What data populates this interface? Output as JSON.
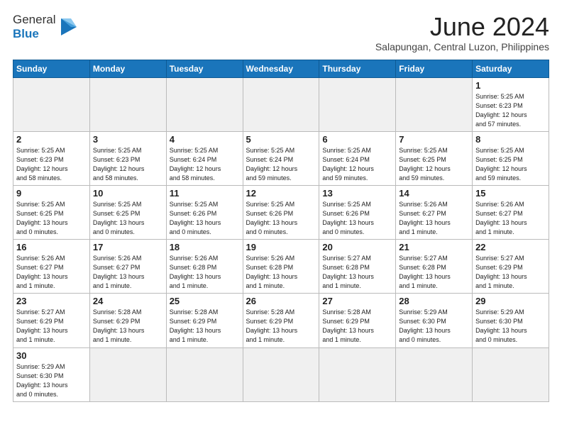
{
  "header": {
    "logo_general": "General",
    "logo_blue": "Blue",
    "month_title": "June 2024",
    "location": "Salapungan, Central Luzon, Philippines"
  },
  "weekdays": [
    "Sunday",
    "Monday",
    "Tuesday",
    "Wednesday",
    "Thursday",
    "Friday",
    "Saturday"
  ],
  "weeks": [
    [
      {
        "day": "",
        "info": "",
        "empty": true
      },
      {
        "day": "",
        "info": "",
        "empty": true
      },
      {
        "day": "",
        "info": "",
        "empty": true
      },
      {
        "day": "",
        "info": "",
        "empty": true
      },
      {
        "day": "",
        "info": "",
        "empty": true
      },
      {
        "day": "",
        "info": "",
        "empty": true
      },
      {
        "day": "1",
        "info": "Sunrise: 5:25 AM\nSunset: 6:23 PM\nDaylight: 12 hours\nand 57 minutes."
      }
    ],
    [
      {
        "day": "2",
        "info": "Sunrise: 5:25 AM\nSunset: 6:23 PM\nDaylight: 12 hours\nand 58 minutes."
      },
      {
        "day": "3",
        "info": "Sunrise: 5:25 AM\nSunset: 6:23 PM\nDaylight: 12 hours\nand 58 minutes."
      },
      {
        "day": "4",
        "info": "Sunrise: 5:25 AM\nSunset: 6:24 PM\nDaylight: 12 hours\nand 58 minutes."
      },
      {
        "day": "5",
        "info": "Sunrise: 5:25 AM\nSunset: 6:24 PM\nDaylight: 12 hours\nand 59 minutes."
      },
      {
        "day": "6",
        "info": "Sunrise: 5:25 AM\nSunset: 6:24 PM\nDaylight: 12 hours\nand 59 minutes."
      },
      {
        "day": "7",
        "info": "Sunrise: 5:25 AM\nSunset: 6:25 PM\nDaylight: 12 hours\nand 59 minutes."
      },
      {
        "day": "8",
        "info": "Sunrise: 5:25 AM\nSunset: 6:25 PM\nDaylight: 12 hours\nand 59 minutes."
      }
    ],
    [
      {
        "day": "9",
        "info": "Sunrise: 5:25 AM\nSunset: 6:25 PM\nDaylight: 13 hours\nand 0 minutes."
      },
      {
        "day": "10",
        "info": "Sunrise: 5:25 AM\nSunset: 6:25 PM\nDaylight: 13 hours\nand 0 minutes."
      },
      {
        "day": "11",
        "info": "Sunrise: 5:25 AM\nSunset: 6:26 PM\nDaylight: 13 hours\nand 0 minutes."
      },
      {
        "day": "12",
        "info": "Sunrise: 5:25 AM\nSunset: 6:26 PM\nDaylight: 13 hours\nand 0 minutes."
      },
      {
        "day": "13",
        "info": "Sunrise: 5:25 AM\nSunset: 6:26 PM\nDaylight: 13 hours\nand 0 minutes."
      },
      {
        "day": "14",
        "info": "Sunrise: 5:26 AM\nSunset: 6:27 PM\nDaylight: 13 hours\nand 1 minute."
      },
      {
        "day": "15",
        "info": "Sunrise: 5:26 AM\nSunset: 6:27 PM\nDaylight: 13 hours\nand 1 minute."
      }
    ],
    [
      {
        "day": "16",
        "info": "Sunrise: 5:26 AM\nSunset: 6:27 PM\nDaylight: 13 hours\nand 1 minute."
      },
      {
        "day": "17",
        "info": "Sunrise: 5:26 AM\nSunset: 6:27 PM\nDaylight: 13 hours\nand 1 minute."
      },
      {
        "day": "18",
        "info": "Sunrise: 5:26 AM\nSunset: 6:28 PM\nDaylight: 13 hours\nand 1 minute."
      },
      {
        "day": "19",
        "info": "Sunrise: 5:26 AM\nSunset: 6:28 PM\nDaylight: 13 hours\nand 1 minute."
      },
      {
        "day": "20",
        "info": "Sunrise: 5:27 AM\nSunset: 6:28 PM\nDaylight: 13 hours\nand 1 minute."
      },
      {
        "day": "21",
        "info": "Sunrise: 5:27 AM\nSunset: 6:28 PM\nDaylight: 13 hours\nand 1 minute."
      },
      {
        "day": "22",
        "info": "Sunrise: 5:27 AM\nSunset: 6:29 PM\nDaylight: 13 hours\nand 1 minute."
      }
    ],
    [
      {
        "day": "23",
        "info": "Sunrise: 5:27 AM\nSunset: 6:29 PM\nDaylight: 13 hours\nand 1 minute."
      },
      {
        "day": "24",
        "info": "Sunrise: 5:28 AM\nSunset: 6:29 PM\nDaylight: 13 hours\nand 1 minute."
      },
      {
        "day": "25",
        "info": "Sunrise: 5:28 AM\nSunset: 6:29 PM\nDaylight: 13 hours\nand 1 minute."
      },
      {
        "day": "26",
        "info": "Sunrise: 5:28 AM\nSunset: 6:29 PM\nDaylight: 13 hours\nand 1 minute."
      },
      {
        "day": "27",
        "info": "Sunrise: 5:28 AM\nSunset: 6:29 PM\nDaylight: 13 hours\nand 1 minute."
      },
      {
        "day": "28",
        "info": "Sunrise: 5:29 AM\nSunset: 6:30 PM\nDaylight: 13 hours\nand 0 minutes."
      },
      {
        "day": "29",
        "info": "Sunrise: 5:29 AM\nSunset: 6:30 PM\nDaylight: 13 hours\nand 0 minutes."
      }
    ],
    [
      {
        "day": "30",
        "info": "Sunrise: 5:29 AM\nSunset: 6:30 PM\nDaylight: 13 hours\nand 0 minutes."
      },
      {
        "day": "",
        "info": "",
        "empty": true
      },
      {
        "day": "",
        "info": "",
        "empty": true
      },
      {
        "day": "",
        "info": "",
        "empty": true
      },
      {
        "day": "",
        "info": "",
        "empty": true
      },
      {
        "day": "",
        "info": "",
        "empty": true
      },
      {
        "day": "",
        "info": "",
        "empty": true
      }
    ]
  ]
}
